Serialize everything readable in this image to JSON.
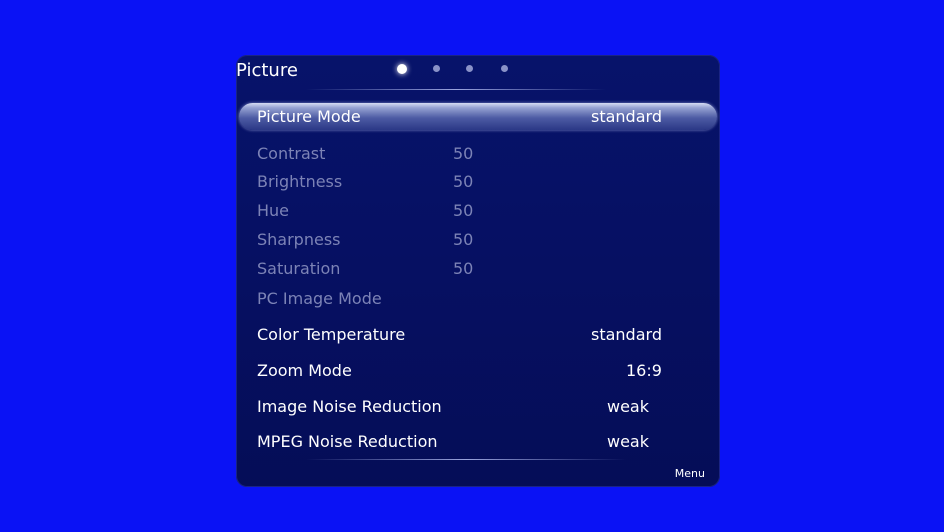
{
  "screen": {
    "title": "Picture",
    "page_dots": [
      {
        "active": true
      },
      {
        "active": false
      },
      {
        "active": false
      },
      {
        "active": false
      }
    ],
    "menu_hint": "Menu"
  },
  "settings": [
    {
      "label": "Picture Mode",
      "value": "standard",
      "state": "selected"
    },
    {
      "label": "Contrast",
      "value": "50",
      "state": "disabled"
    },
    {
      "label": "Brightness",
      "value": "50",
      "state": "disabled"
    },
    {
      "label": "Hue",
      "value": "50",
      "state": "disabled"
    },
    {
      "label": "Sharpness",
      "value": "50",
      "state": "disabled"
    },
    {
      "label": "Saturation",
      "value": "50",
      "state": "disabled"
    },
    {
      "label": "PC Image Mode",
      "value": "",
      "state": "disabled"
    },
    {
      "label": "Color Temperature",
      "value": "standard",
      "state": "enabled"
    },
    {
      "label": "Zoom Mode",
      "value": "16:9",
      "state": "enabled"
    },
    {
      "label": "Image Noise Reduction",
      "value": "weak",
      "state": "enabled"
    },
    {
      "label": "MPEG Noise Reduction",
      "value": "weak",
      "state": "enabled"
    }
  ],
  "colors": {
    "background": "#0a12f5",
    "panel": "#061063",
    "text_enabled": "#ffffff",
    "text_disabled": "#7c83b6"
  }
}
